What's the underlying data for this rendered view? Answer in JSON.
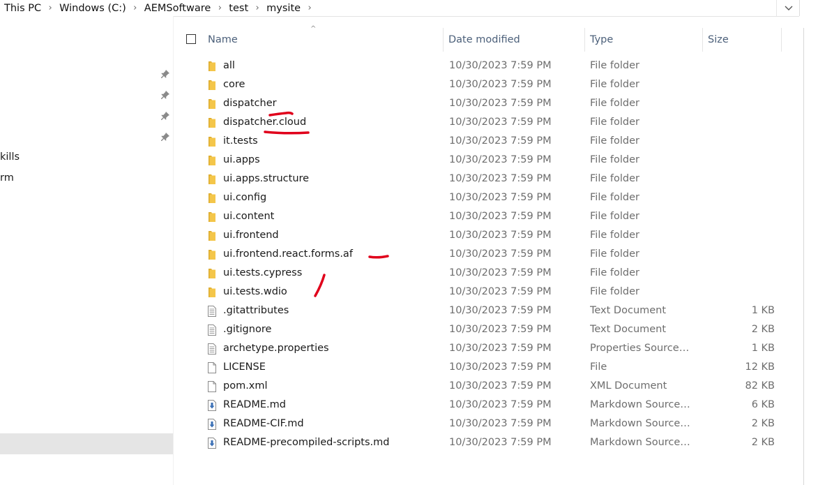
{
  "breadcrumb": {
    "items": [
      "This PC",
      "Windows (C:)",
      "AEMSoftware",
      "test",
      "mysite"
    ],
    "separator_icon": "chevron-right-icon",
    "dropdown_icon": "chevron-down-icon"
  },
  "nav": {
    "items": [
      {
        "label": "kills"
      },
      {
        "label": "rm"
      }
    ],
    "pin_icon": "pin-icon"
  },
  "columns": {
    "name": "Name",
    "date": "Date modified",
    "type": "Type",
    "size": "Size"
  },
  "files": [
    {
      "name": "all",
      "date": "10/30/2023 7:59 PM",
      "type": "File folder",
      "size": "",
      "icon": "folder-icon"
    },
    {
      "name": "core",
      "date": "10/30/2023 7:59 PM",
      "type": "File folder",
      "size": "",
      "icon": "folder-icon"
    },
    {
      "name": "dispatcher",
      "date": "10/30/2023 7:59 PM",
      "type": "File folder",
      "size": "",
      "icon": "folder-icon"
    },
    {
      "name": "dispatcher.cloud",
      "date": "10/30/2023 7:59 PM",
      "type": "File folder",
      "size": "",
      "icon": "folder-icon"
    },
    {
      "name": "it.tests",
      "date": "10/30/2023 7:59 PM",
      "type": "File folder",
      "size": "",
      "icon": "folder-icon"
    },
    {
      "name": "ui.apps",
      "date": "10/30/2023 7:59 PM",
      "type": "File folder",
      "size": "",
      "icon": "folder-icon"
    },
    {
      "name": "ui.apps.structure",
      "date": "10/30/2023 7:59 PM",
      "type": "File folder",
      "size": "",
      "icon": "folder-icon"
    },
    {
      "name": "ui.config",
      "date": "10/30/2023 7:59 PM",
      "type": "File folder",
      "size": "",
      "icon": "folder-icon"
    },
    {
      "name": "ui.content",
      "date": "10/30/2023 7:59 PM",
      "type": "File folder",
      "size": "",
      "icon": "folder-icon"
    },
    {
      "name": "ui.frontend",
      "date": "10/30/2023 7:59 PM",
      "type": "File folder",
      "size": "",
      "icon": "folder-icon"
    },
    {
      "name": "ui.frontend.react.forms.af",
      "date": "10/30/2023 7:59 PM",
      "type": "File folder",
      "size": "",
      "icon": "folder-icon"
    },
    {
      "name": "ui.tests.cypress",
      "date": "10/30/2023 7:59 PM",
      "type": "File folder",
      "size": "",
      "icon": "folder-icon"
    },
    {
      "name": "ui.tests.wdio",
      "date": "10/30/2023 7:59 PM",
      "type": "File folder",
      "size": "",
      "icon": "folder-icon"
    },
    {
      "name": ".gitattributes",
      "date": "10/30/2023 7:59 PM",
      "type": "Text Document",
      "size": "1 KB",
      "icon": "text-file-icon"
    },
    {
      "name": ".gitignore",
      "date": "10/30/2023 7:59 PM",
      "type": "Text Document",
      "size": "2 KB",
      "icon": "text-file-icon"
    },
    {
      "name": "archetype.properties",
      "date": "10/30/2023 7:59 PM",
      "type": "Properties Source…",
      "size": "1 KB",
      "icon": "text-file-icon"
    },
    {
      "name": "LICENSE",
      "date": "10/30/2023 7:59 PM",
      "type": "File",
      "size": "12 KB",
      "icon": "blank-file-icon"
    },
    {
      "name": "pom.xml",
      "date": "10/30/2023 7:59 PM",
      "type": "XML Document",
      "size": "82 KB",
      "icon": "blank-file-icon"
    },
    {
      "name": "README.md",
      "date": "10/30/2023 7:59 PM",
      "type": "Markdown Source…",
      "size": "6 KB",
      "icon": "markdown-file-icon"
    },
    {
      "name": "README-CIF.md",
      "date": "10/30/2023 7:59 PM",
      "type": "Markdown Source…",
      "size": "2 KB",
      "icon": "markdown-file-icon"
    },
    {
      "name": "README-precompiled-scripts.md",
      "date": "10/30/2023 7:59 PM",
      "type": "Markdown Source…",
      "size": "2 KB",
      "icon": "markdown-file-icon"
    }
  ],
  "colors": {
    "folder": "#f4c64a",
    "folder_dark": "#dcaa2a",
    "annotation": "#e0001b",
    "header_text": "#4c607a",
    "selection": "#e5e5e5",
    "md_arrow": "#3a6fb5"
  }
}
